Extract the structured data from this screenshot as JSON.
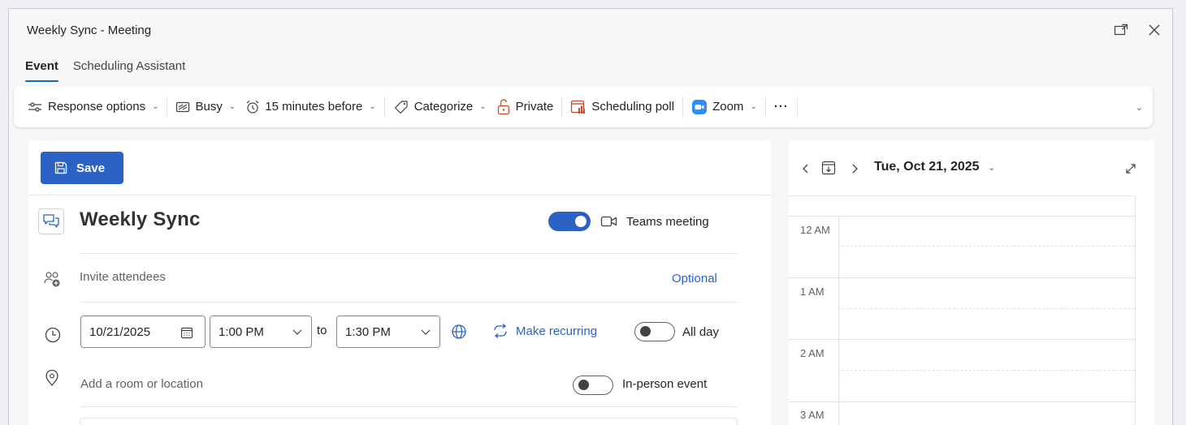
{
  "window": {
    "title": "Weekly Sync - Meeting"
  },
  "tabs": [
    {
      "label": "Event",
      "active": true
    },
    {
      "label": "Scheduling Assistant",
      "active": false
    }
  ],
  "ribbon": {
    "response_options": "Response options",
    "busy": "Busy",
    "reminder": "15 minutes before",
    "categorize": "Categorize",
    "private": "Private",
    "scheduling_poll": "Scheduling poll",
    "zoom": "Zoom",
    "more": "···"
  },
  "form": {
    "save_label": "Save",
    "title_value": "Weekly Sync",
    "teams_meeting_label": "Teams meeting",
    "teams_meeting_on": true,
    "attendees_placeholder": "Invite attendees",
    "optional_label": "Optional",
    "date_value": "10/21/2025",
    "start_time": "1:00 PM",
    "to_label": "to",
    "end_time": "1:30 PM",
    "make_recurring_label": "Make recurring",
    "all_day_label": "All day",
    "all_day_on": false,
    "location_placeholder": "Add a room or location",
    "in_person_label": "In-person event",
    "in_person_on": false
  },
  "calendar": {
    "date_label": "Tue, Oct 21, 2025",
    "hours": [
      "12 AM",
      "1 AM",
      "2 AM",
      "3 AM"
    ]
  },
  "colors": {
    "accent": "#2c62c4",
    "scheduling_poll_orange": "#c4492e",
    "zoom_blue": "#2d8cff"
  }
}
